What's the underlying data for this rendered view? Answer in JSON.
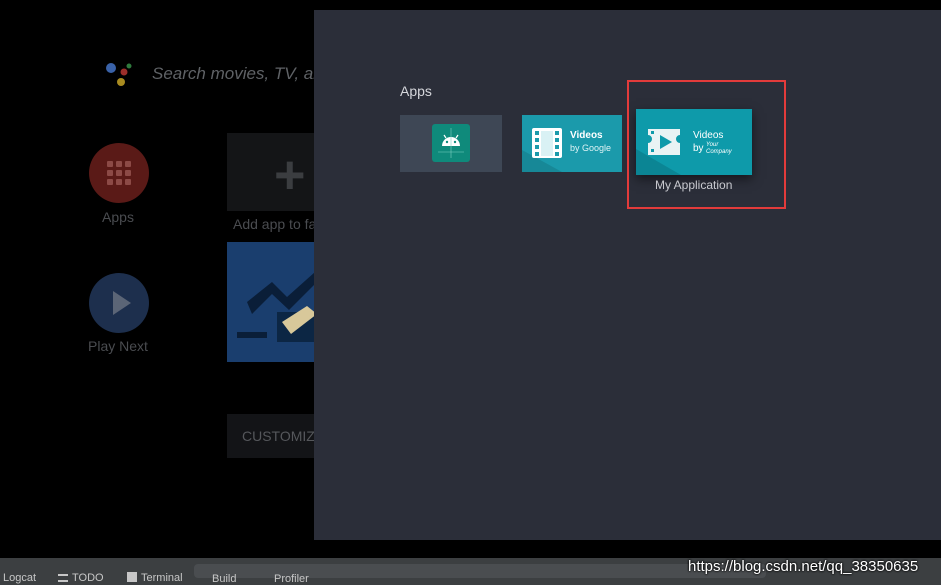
{
  "home": {
    "search_placeholder": "Search movies, TV, ar",
    "apps_label": "Apps",
    "play_next_label": "Play Next",
    "add_app_label": "Add app to fa",
    "customize_label": "CUSTOMIZE"
  },
  "apps_panel": {
    "title": "Apps",
    "tiles": [
      {
        "name": "Android app"
      },
      {
        "title": "Videos",
        "subtitle": "by Google"
      },
      {
        "title": "Videos",
        "by": "by",
        "company": "Your Company",
        "label": "My Application"
      }
    ]
  },
  "status_bar": {
    "items": [
      "Logcat",
      "TODO",
      "Terminal",
      "Build",
      "Profiler"
    ]
  },
  "watermark": "https://blog.csdn.net/qq_38350635",
  "colors": {
    "panel_bg": "#2b2e39",
    "tile_teal": "#0e9aaa",
    "highlight": "#e33b3b"
  }
}
